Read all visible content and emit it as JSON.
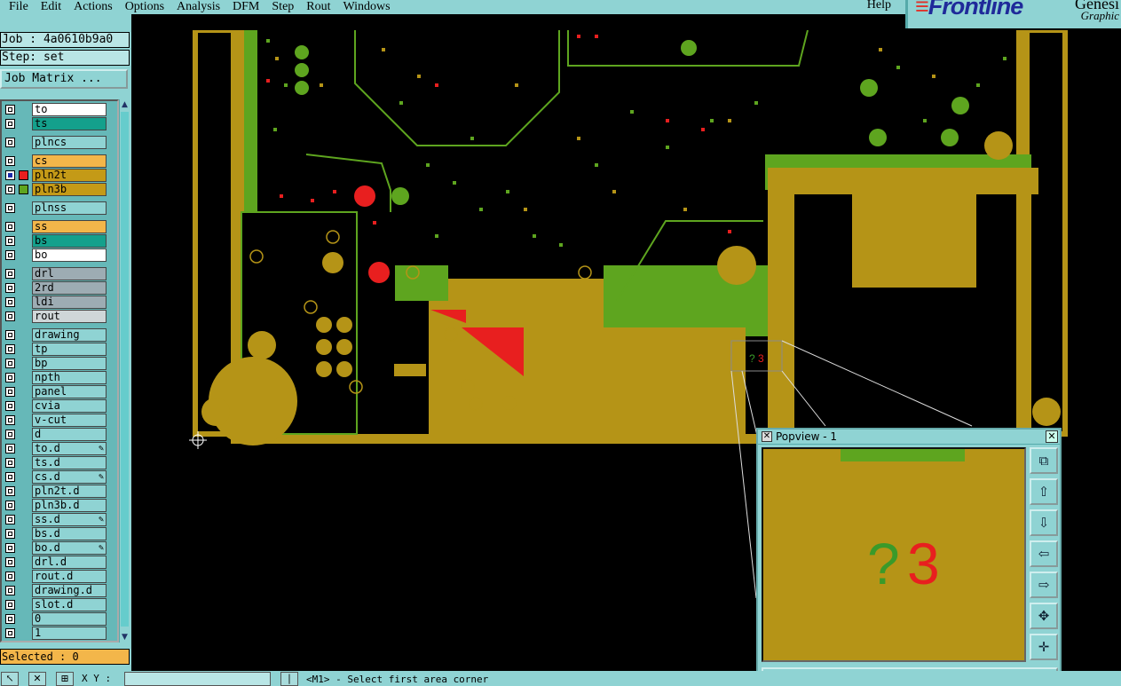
{
  "menubar": {
    "items": [
      "File",
      "Edit",
      "Actions",
      "Options",
      "Analysis",
      "DFM",
      "Step",
      "Rout",
      "Windows"
    ],
    "help": "Help"
  },
  "logo": {
    "brand": "Frontline",
    "sub": "Graphic",
    "sub2": "Genesi"
  },
  "job": {
    "label": "Job : 4a0610b9a0",
    "step": "Step: set",
    "matrix_button": "Job Matrix ..."
  },
  "layers": [
    {
      "name": "to",
      "color": "white"
    },
    {
      "name": "ts",
      "color": "teal"
    },
    {
      "name": "plncs",
      "color": "none"
    },
    {
      "name": "cs",
      "color": "orange"
    },
    {
      "name": "pln2t",
      "color": "olive",
      "marker": "red",
      "affected": true
    },
    {
      "name": "pln3b",
      "color": "olive",
      "marker": "green"
    },
    {
      "name": "plnss",
      "color": "none"
    },
    {
      "name": "ss",
      "color": "orange"
    },
    {
      "name": "bs",
      "color": "teal"
    },
    {
      "name": "bo",
      "color": "white"
    },
    {
      "name": "drl",
      "color": "grey"
    },
    {
      "name": "2rd",
      "color": "grey"
    },
    {
      "name": "ldi",
      "color": "grey"
    },
    {
      "name": "rout",
      "color": "lgrey"
    },
    {
      "name": "drawing",
      "color": "none"
    },
    {
      "name": "tp",
      "color": "none"
    },
    {
      "name": "bp",
      "color": "none"
    },
    {
      "name": "npth",
      "color": "none"
    },
    {
      "name": "panel",
      "color": "none"
    },
    {
      "name": "cvia",
      "color": "none"
    },
    {
      "name": "v-cut",
      "color": "none"
    },
    {
      "name": "d",
      "color": "none"
    },
    {
      "name": "to.d",
      "color": "none",
      "edit": true
    },
    {
      "name": "ts.d",
      "color": "none"
    },
    {
      "name": "cs.d",
      "color": "none",
      "edit": true
    },
    {
      "name": "pln2t.d",
      "color": "none"
    },
    {
      "name": "pln3b.d",
      "color": "none"
    },
    {
      "name": "ss.d",
      "color": "none",
      "edit": true
    },
    {
      "name": "bs.d",
      "color": "none"
    },
    {
      "name": "bo.d",
      "color": "none",
      "edit": true
    },
    {
      "name": "drl.d",
      "color": "none"
    },
    {
      "name": "rout.d",
      "color": "none"
    },
    {
      "name": "drawing.d",
      "color": "none"
    },
    {
      "name": "slot.d",
      "color": "none"
    },
    {
      "name": "0",
      "color": "none"
    },
    {
      "name": "1",
      "color": "none"
    }
  ],
  "selected": "Selected : 0",
  "bottom": {
    "xy_label": "X Y :",
    "status": "<M1> - Select first area corner"
  },
  "popview": {
    "title": "Popview - 1",
    "text_green": "?",
    "text_red": "3",
    "close": "Close",
    "canvas_text": "?3"
  },
  "colors": {
    "ui": "#8fd3d3",
    "copper": "#b59417",
    "green": "#5ea51f",
    "red": "#e81f1f"
  }
}
